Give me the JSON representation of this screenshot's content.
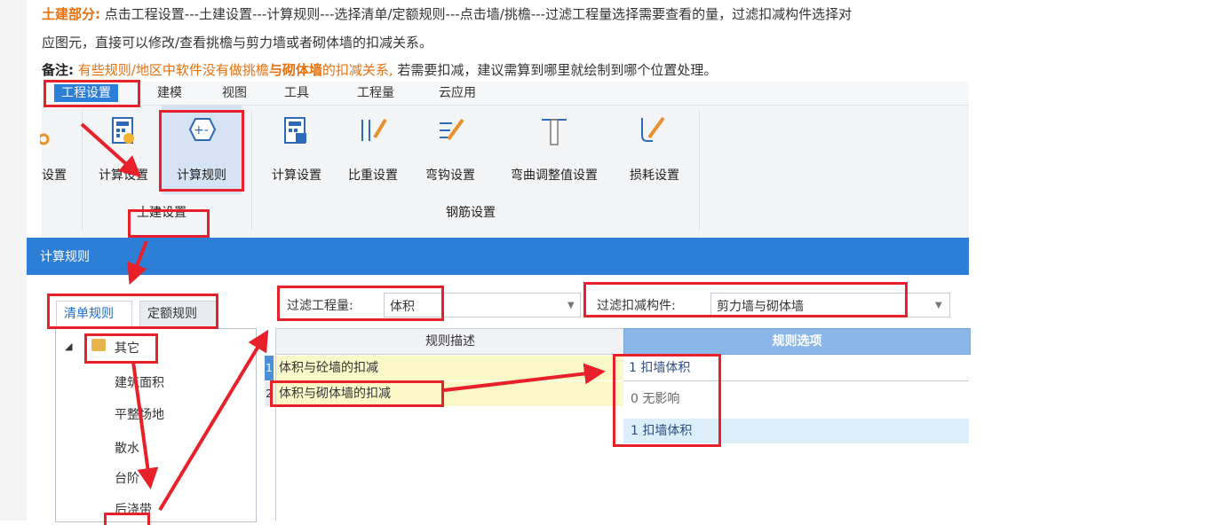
{
  "notes": {
    "line1_label": "土建部分:",
    "line1_text": "点击工程设置---土建设置---计算规则---选择清单/定额规则---点击墙/挑檐---过滤工程量选择需要查看的量，过滤扣减构件选择对",
    "line2_text": "应图元，直接可以修改/查看挑檐与剪力墙或者砌体墙的扣减关系。",
    "line3_label": "备注:",
    "line3_part1": "有些规则/地区中软件没有做挑檐",
    "line3_part2": "与砌体墙",
    "line3_part3": "的扣减关系,",
    "line3_part4": "若需要扣减，建议需算到哪里就绘制到哪个位置处理。"
  },
  "menu": [
    "工程设置",
    "建模",
    "视图",
    "工具",
    "工程量",
    "云应用"
  ],
  "toolbar": {
    "partial": "设置",
    "civil_calc": "计算设置",
    "civil_rules": "计算规则",
    "civil_group": "土建设置",
    "rebar_calc": "计算设置",
    "rebar_weight": "比重设置",
    "rebar_hook": "弯钩设置",
    "rebar_bend": "弯曲调整值设置",
    "rebar_loss": "损耗设置",
    "rebar_group": "钢筋设置"
  },
  "window_title": "计算规则",
  "tabs": [
    "清单规则",
    "定额规则"
  ],
  "tree": {
    "root": "其它",
    "children": [
      "建筑面积",
      "平整场地",
      "散水",
      "台阶",
      "后浇带"
    ]
  },
  "filters": {
    "qty_label": "过滤工程量:",
    "qty_value": "体积",
    "deduct_label": "过滤扣减构件:",
    "deduct_value": "剪力墙与砌体墙"
  },
  "grid": {
    "col_desc": "规则描述",
    "col_option": "规则选项",
    "rows": [
      {
        "num": "1",
        "desc": "体积与砼墙的扣减",
        "option": "1 扣墙体积"
      },
      {
        "num": "2",
        "desc": "体积与砌体墙的扣减",
        "option": "0 无影响"
      }
    ],
    "extra_option": "1 扣墙体积"
  },
  "colors": {
    "accent": "#2d7ed7",
    "annotation": "#e8202a",
    "note": "#e8700f"
  }
}
